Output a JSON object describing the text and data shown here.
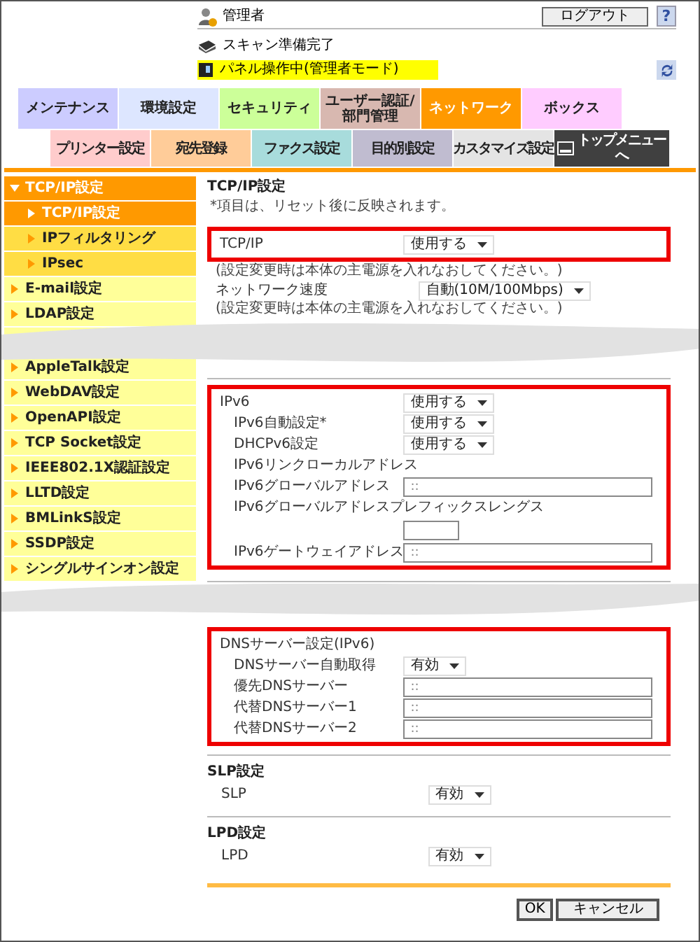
{
  "header": {
    "user": "管理者",
    "logout": "ログアウト",
    "help": "?"
  },
  "status": {
    "scan": "スキャン準備完了",
    "panel": "パネル操作中(管理者モード)"
  },
  "main_tabs": [
    {
      "label": "メンテナンス",
      "color": "#ccccff",
      "selected": false
    },
    {
      "label": "環境設定",
      "color": "#dde6ff",
      "selected": false
    },
    {
      "label": "セキュリティ",
      "color": "#ccff99",
      "selected": false
    },
    {
      "label": "ユーザー認証/部門管理",
      "color": "#d8b8b0",
      "selected": false
    },
    {
      "label": "ネットワーク",
      "color": "#ff9900",
      "selected": true
    },
    {
      "label": "ボックス",
      "color": "#ffccff",
      "selected": false
    }
  ],
  "sub_tabs": [
    {
      "label": "プリンター設定",
      "color": "#ffcccc"
    },
    {
      "label": "宛先登録",
      "color": "#ffcc99"
    },
    {
      "label": "ファクス設定",
      "color": "#a8dcdc"
    },
    {
      "label": "目的別設定",
      "color": "#c0bcd0"
    },
    {
      "label": "カスタマイズ設定",
      "color": "#e4e4e4"
    }
  ],
  "top_menu": "トップメニューへ",
  "sidebar": {
    "sections": [
      {
        "items": [
          {
            "label": "TCP/IP設定",
            "expanded": true,
            "children": [
              {
                "label": "TCP/IP設定",
                "selected": true
              },
              {
                "label": "IPフィルタリング",
                "selected": false
              },
              {
                "label": "IPsec",
                "selected": false
              }
            ]
          },
          {
            "label": "E-mail設定",
            "expanded": false
          },
          {
            "label": "LDAP設定",
            "expanded": false
          }
        ]
      },
      {
        "items": [
          {
            "label": "AppleTalk設定",
            "expanded": false
          },
          {
            "label": "WebDAV設定",
            "expanded": false
          },
          {
            "label": "OpenAPI設定",
            "expanded": false
          },
          {
            "label": "TCP Socket設定",
            "expanded": false
          },
          {
            "label": "IEEE802.1X認証設定",
            "expanded": false
          },
          {
            "label": "LLTD設定",
            "expanded": false
          },
          {
            "label": "BMLinkS設定",
            "expanded": false
          },
          {
            "label": "SSDP設定",
            "expanded": false
          },
          {
            "label": "シングルサインオン設定",
            "expanded": false
          }
        ]
      }
    ]
  },
  "main": {
    "title": "TCP/IP設定",
    "note": "*項目は、リセット後に反映されます。",
    "parts": [
      {
        "sections": [
          {
            "highlighted": true,
            "rows": [
              {
                "kind": "select",
                "label": "TCP/IP",
                "value": "使用する"
              }
            ]
          },
          {
            "rows": [
              {
                "kind": "note",
                "label": "(設定変更時は本体の主電源を入れなおしてください。)"
              },
              {
                "kind": "select",
                "label": "ネットワーク速度",
                "value": "自動(10M/100Mbps)"
              },
              {
                "kind": "note",
                "label": "(設定変更時は本体の主電源を入れなおしてください。)"
              }
            ]
          }
        ]
      },
      {
        "sections": [
          {
            "highlighted": true,
            "rows": [
              {
                "kind": "select",
                "label": "IPv6",
                "value": "使用する",
                "children": [
                  {
                    "kind": "select",
                    "label": "IPv6自動設定*",
                    "value": "使用する"
                  },
                  {
                    "kind": "select",
                    "label": "DHCPv6設定",
                    "value": "使用する"
                  },
                  {
                    "kind": "label",
                    "label": "IPv6リンクローカルアドレス"
                  },
                  {
                    "kind": "input",
                    "label": "IPv6グローバルアドレス",
                    "value": "::"
                  },
                  {
                    "kind": "input_below",
                    "label": "IPv6グローバルアドレスプレフィックスレングス"
                  },
                  {
                    "kind": "input",
                    "label": "IPv6ゲートウェイアドレス",
                    "value": "::"
                  }
                ]
              }
            ]
          }
        ]
      },
      {
        "sections": [
          {
            "highlighted": true,
            "rows": [
              {
                "kind": "label",
                "label": "DNSサーバー設定(IPv6)",
                "children": [
                  {
                    "kind": "select",
                    "label": "DNSサーバー自動取得",
                    "value": "有効"
                  },
                  {
                    "kind": "input",
                    "label": "優先DNSサーバー",
                    "value": "::"
                  },
                  {
                    "kind": "input",
                    "label": "代替DNSサーバー1",
                    "value": "::"
                  },
                  {
                    "kind": "input",
                    "label": "代替DNSサーバー2",
                    "value": "::"
                  }
                ]
              }
            ]
          },
          {
            "title": "SLP設定",
            "rows": [
              {
                "kind": "select_wide",
                "label": "SLP",
                "value": "有効"
              }
            ]
          },
          {
            "title": "LPD設定",
            "rows": [
              {
                "kind": "select_wide",
                "label": "LPD",
                "value": "有効"
              }
            ]
          }
        ]
      }
    ]
  },
  "buttons": [
    "OK",
    "キャンセル"
  ]
}
